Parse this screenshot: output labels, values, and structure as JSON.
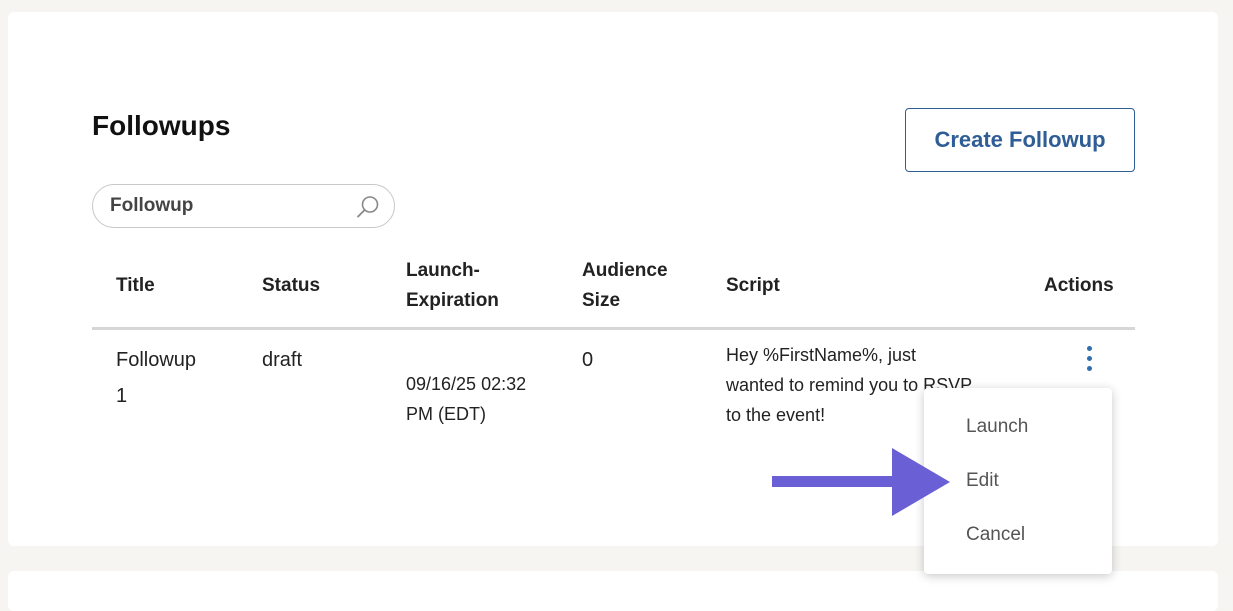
{
  "page": {
    "title": "Followups",
    "create_button": "Create Followup"
  },
  "search": {
    "placeholder": "Followup",
    "icon": "search-icon"
  },
  "table": {
    "columns": [
      "Title",
      "Status",
      "Launch-\nExpiration",
      "Audience\nSize",
      "Script",
      "Actions"
    ],
    "rows": [
      {
        "title": "Followup\n1",
        "status": "draft",
        "launch_expiration": "09/16/25 02:32\nPM (EDT)",
        "audience_size": "0",
        "script": "Hey %FirstName%, just\nwanted to remind you to RSVP\nto the event!",
        "actions_icon": "more-vertical-icon"
      }
    ]
  },
  "actions_menu": {
    "items": [
      "Launch",
      "Edit",
      "Cancel"
    ]
  },
  "annotation": {
    "arrow_color": "#6a5fd4",
    "points_to": "Edit"
  },
  "colors": {
    "accent": "#2f5d95",
    "kebab": "#2f6eb0",
    "background": "#f6f5f2"
  }
}
